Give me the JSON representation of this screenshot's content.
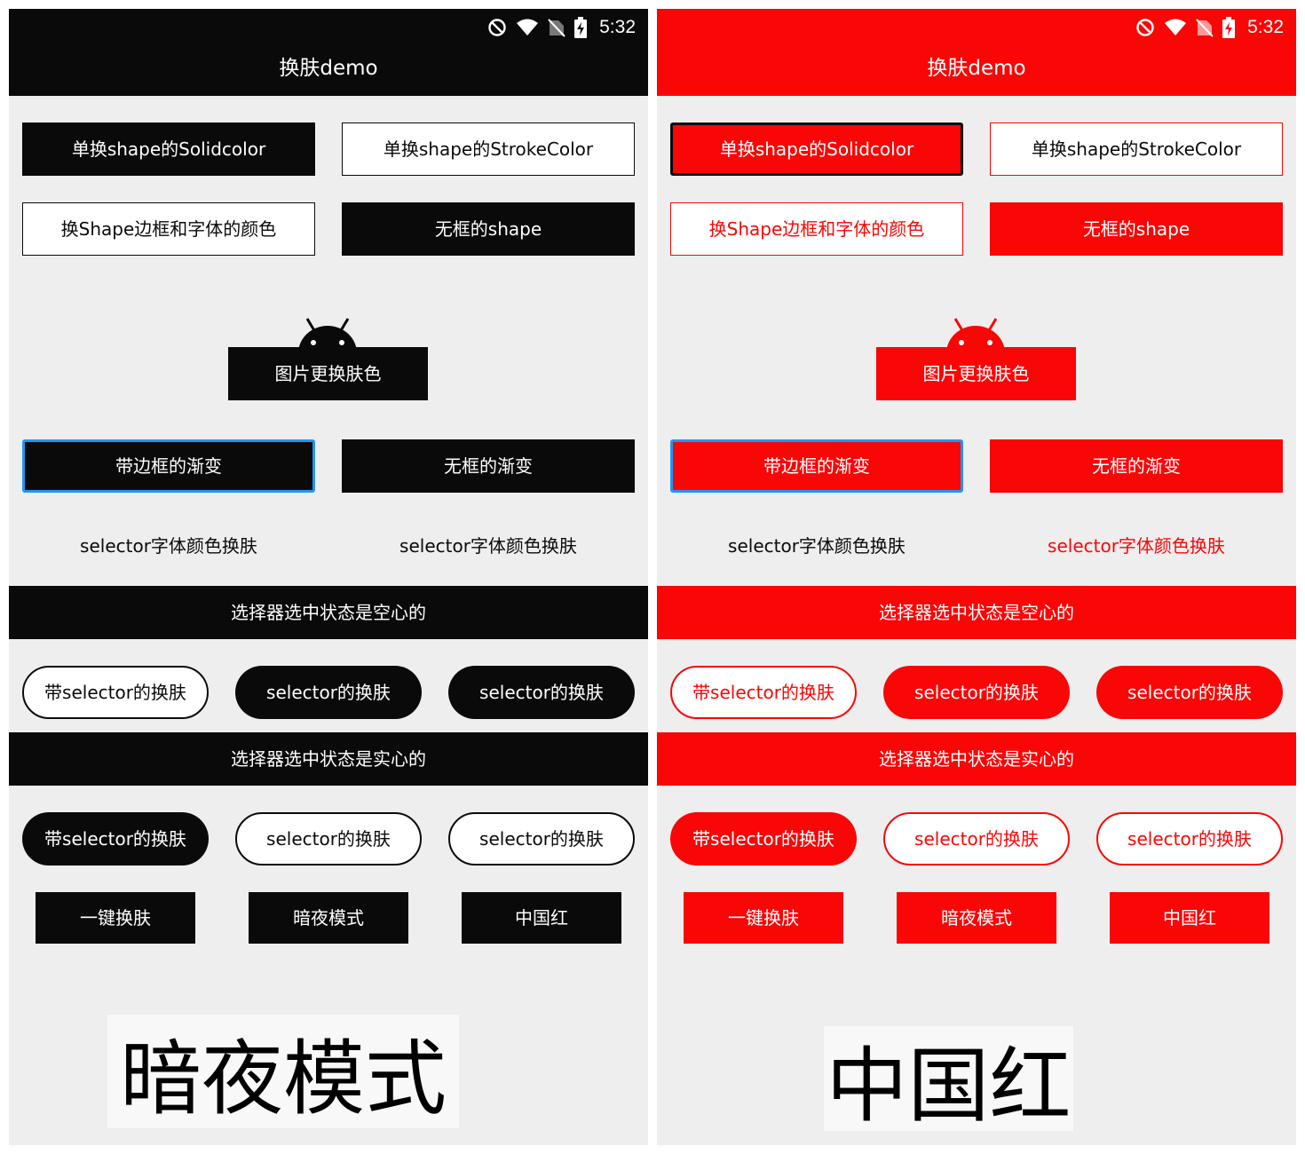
{
  "theme": {
    "left_primary": "#0a0a0a",
    "right_primary": "#f90606",
    "background": "#eeeeee",
    "white": "#ffffff",
    "gradient_border": "#2196f3"
  },
  "status_bar": {
    "time": "5:32",
    "icons": [
      "do-not-disturb-icon",
      "wifi-icon",
      "no-sim-icon",
      "battery-charging-icon"
    ]
  },
  "app": {
    "title": "换肤demo"
  },
  "buttons": {
    "solid_color": "单换shape的Solidcolor",
    "stroke_color": "单换shape的StrokeColor",
    "border_and_font": "换Shape边框和字体的颜色",
    "no_border_shape": "无框的shape",
    "image_skin": "图片更换肤色",
    "border_gradient": "带边框的渐变",
    "no_border_gradient": "无框的渐变",
    "selector_font_left": "selector字体颜色换肤",
    "selector_font_right": "selector字体颜色换肤"
  },
  "section_hollow": {
    "title": "选择器选中状态是空心的",
    "items": [
      "带selector的换肤",
      "selector的换肤",
      "selector的换肤"
    ]
  },
  "section_solid": {
    "title": "选择器选中状态是实心的",
    "items": [
      "带selector的换肤",
      "selector的换肤",
      "selector的换肤"
    ]
  },
  "skin_buttons": [
    "一键换肤",
    "暗夜模式",
    "中国红"
  ],
  "mode_label_left": "暗夜模式",
  "mode_label_right": "中国红"
}
